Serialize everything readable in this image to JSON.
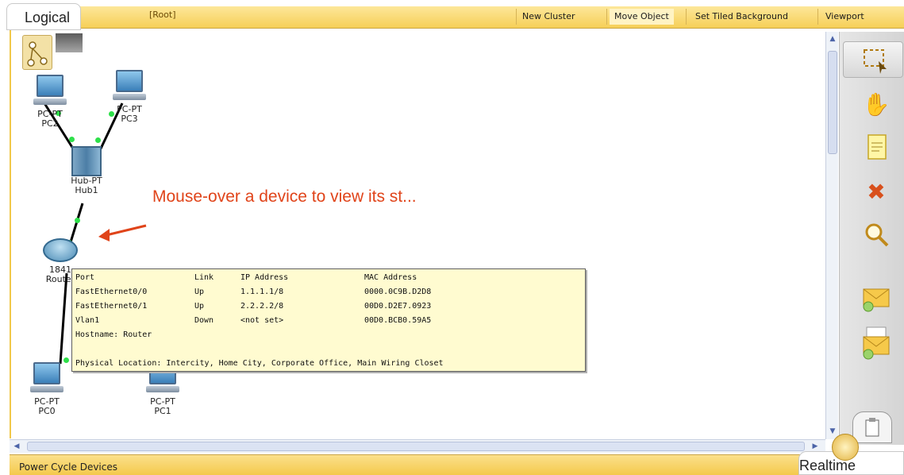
{
  "topbar": {
    "root": "[Root]",
    "buttons": [
      "New Cluster",
      "Move Object",
      "Set Tiled Background",
      "Viewport"
    ]
  },
  "tabs": {
    "logical": "Logical",
    "realtime": "Realtime"
  },
  "bottombar": {
    "power_cycle": "Power Cycle Devices"
  },
  "devices": {
    "pc2": {
      "model": "PC-PT",
      "name": "PC2"
    },
    "pc3": {
      "model": "PC-PT",
      "name": "PC3"
    },
    "hub": {
      "model": "Hub-PT",
      "name": "Hub1"
    },
    "router": {
      "model": "1841",
      "name": "Router"
    },
    "pc0": {
      "model": "PC-PT",
      "name": "PC0"
    },
    "pc1": {
      "model": "PC-PT",
      "name": "PC1"
    }
  },
  "annotation": "Mouse-over a device to view its st...",
  "tooltip": {
    "headers": [
      "Port",
      "Link",
      "IP Address",
      "MAC Address"
    ],
    "rows": [
      [
        "FastEthernet0/0",
        "Up",
        "1.1.1.1/8",
        "0000.0C9B.D2D8"
      ],
      [
        "FastEthernet0/1",
        "Up",
        "2.2.2.2/8",
        "00D0.D2E7.0923"
      ],
      [
        "Vlan1",
        "Down",
        "<not set>",
        "00D0.BCB0.59A5"
      ]
    ],
    "hostname": "Hostname: Router",
    "location": "Physical Location: Intercity, Home City, Corporate Office, Main Wiring Closet"
  },
  "icons": [
    "select-icon",
    "hand-icon",
    "note-icon",
    "delete-icon",
    "inspect-icon",
    "add-simple-pdu-icon",
    "add-complex-pdu-icon",
    "clock-icon"
  ],
  "colors": {
    "accent": "#f4c94c",
    "annotation": "#e0441a",
    "tooltip_bg": "#fffbd0",
    "link_dot": "#2ee04a"
  }
}
